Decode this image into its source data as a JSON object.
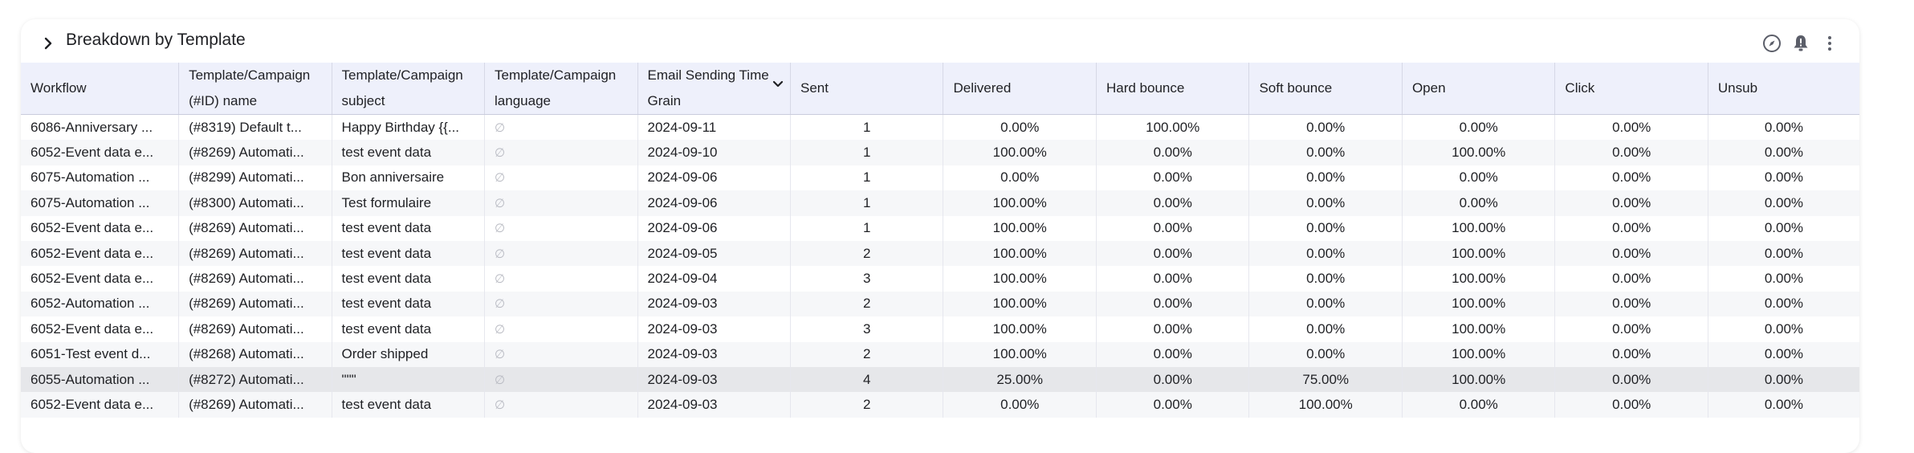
{
  "panel": {
    "title": "Breakdown by Template"
  },
  "icons": {
    "toggle": "chevron-right-icon",
    "explore": "compass-icon",
    "alert": "bell-alert-icon",
    "menu": "more-vertical-icon"
  },
  "columns": [
    {
      "lines": [
        "Workflow"
      ]
    },
    {
      "lines": [
        "Template/Campaign",
        "(#ID) name"
      ]
    },
    {
      "lines": [
        "Template/Campaign",
        "subject"
      ]
    },
    {
      "lines": [
        "Template/Campaign",
        "language"
      ]
    },
    {
      "lines": [
        "Email Sending Time",
        "Grain"
      ]
    },
    {
      "lines": [
        "Sent"
      ]
    },
    {
      "lines": [
        "Delivered"
      ]
    },
    {
      "lines": [
        "Hard bounce"
      ]
    },
    {
      "lines": [
        "Soft bounce"
      ]
    },
    {
      "lines": [
        "Open"
      ]
    },
    {
      "lines": [
        "Click"
      ]
    },
    {
      "lines": [
        "Unsub"
      ]
    }
  ],
  "null_symbol": "∅",
  "rows": [
    [
      "6086-Anniversary ...",
      "(#8319) Default t...",
      "Happy Birthday {{...",
      "∅",
      "2024-09-11",
      "1",
      "0.00%",
      "100.00%",
      "0.00%",
      "0.00%",
      "0.00%",
      "0.00%"
    ],
    [
      "6052-Event data e...",
      "(#8269) Automati...",
      "test event data",
      "∅",
      "2024-09-10",
      "1",
      "100.00%",
      "0.00%",
      "0.00%",
      "100.00%",
      "0.00%",
      "0.00%"
    ],
    [
      "6075-Automation ...",
      "(#8299) Automati...",
      "Bon anniversaire",
      "∅",
      "2024-09-06",
      "1",
      "0.00%",
      "0.00%",
      "0.00%",
      "0.00%",
      "0.00%",
      "0.00%"
    ],
    [
      "6075-Automation ...",
      "(#8300) Automati...",
      "Test formulaire",
      "∅",
      "2024-09-06",
      "1",
      "100.00%",
      "0.00%",
      "0.00%",
      "0.00%",
      "0.00%",
      "0.00%"
    ],
    [
      "6052-Event data e...",
      "(#8269) Automati...",
      "test event data",
      "∅",
      "2024-09-06",
      "1",
      "100.00%",
      "0.00%",
      "0.00%",
      "100.00%",
      "0.00%",
      "0.00%"
    ],
    [
      "6052-Event data e...",
      "(#8269) Automati...",
      "test event data",
      "∅",
      "2024-09-05",
      "2",
      "100.00%",
      "0.00%",
      "0.00%",
      "100.00%",
      "0.00%",
      "0.00%"
    ],
    [
      "6052-Event data e...",
      "(#8269) Automati...",
      "test event data",
      "∅",
      "2024-09-04",
      "3",
      "100.00%",
      "0.00%",
      "0.00%",
      "100.00%",
      "0.00%",
      "0.00%"
    ],
    [
      "6052-Automation ...",
      "(#8269) Automati...",
      "test event data",
      "∅",
      "2024-09-03",
      "2",
      "100.00%",
      "0.00%",
      "0.00%",
      "100.00%",
      "0.00%",
      "0.00%"
    ],
    [
      "6052-Event data e...",
      "(#8269) Automati...",
      "test event data",
      "∅",
      "2024-09-03",
      "3",
      "100.00%",
      "0.00%",
      "0.00%",
      "100.00%",
      "0.00%",
      "0.00%"
    ],
    [
      "6051-Test event d...",
      "(#8268) Automati...",
      "Order shipped",
      "∅",
      "2024-09-03",
      "2",
      "100.00%",
      "0.00%",
      "0.00%",
      "100.00%",
      "0.00%",
      "0.00%"
    ],
    [
      "6055-Automation ...",
      "(#8272) Automati...",
      "\"\"\"",
      "∅",
      "2024-09-03",
      "4",
      "25.00%",
      "0.00%",
      "75.00%",
      "100.00%",
      "0.00%",
      "0.00%"
    ],
    [
      "6052-Event data e...",
      "(#8269) Automati...",
      "test event data",
      "∅",
      "2024-09-03",
      "2",
      "0.00%",
      "0.00%",
      "100.00%",
      "0.00%",
      "0.00%",
      "0.00%"
    ]
  ]
}
